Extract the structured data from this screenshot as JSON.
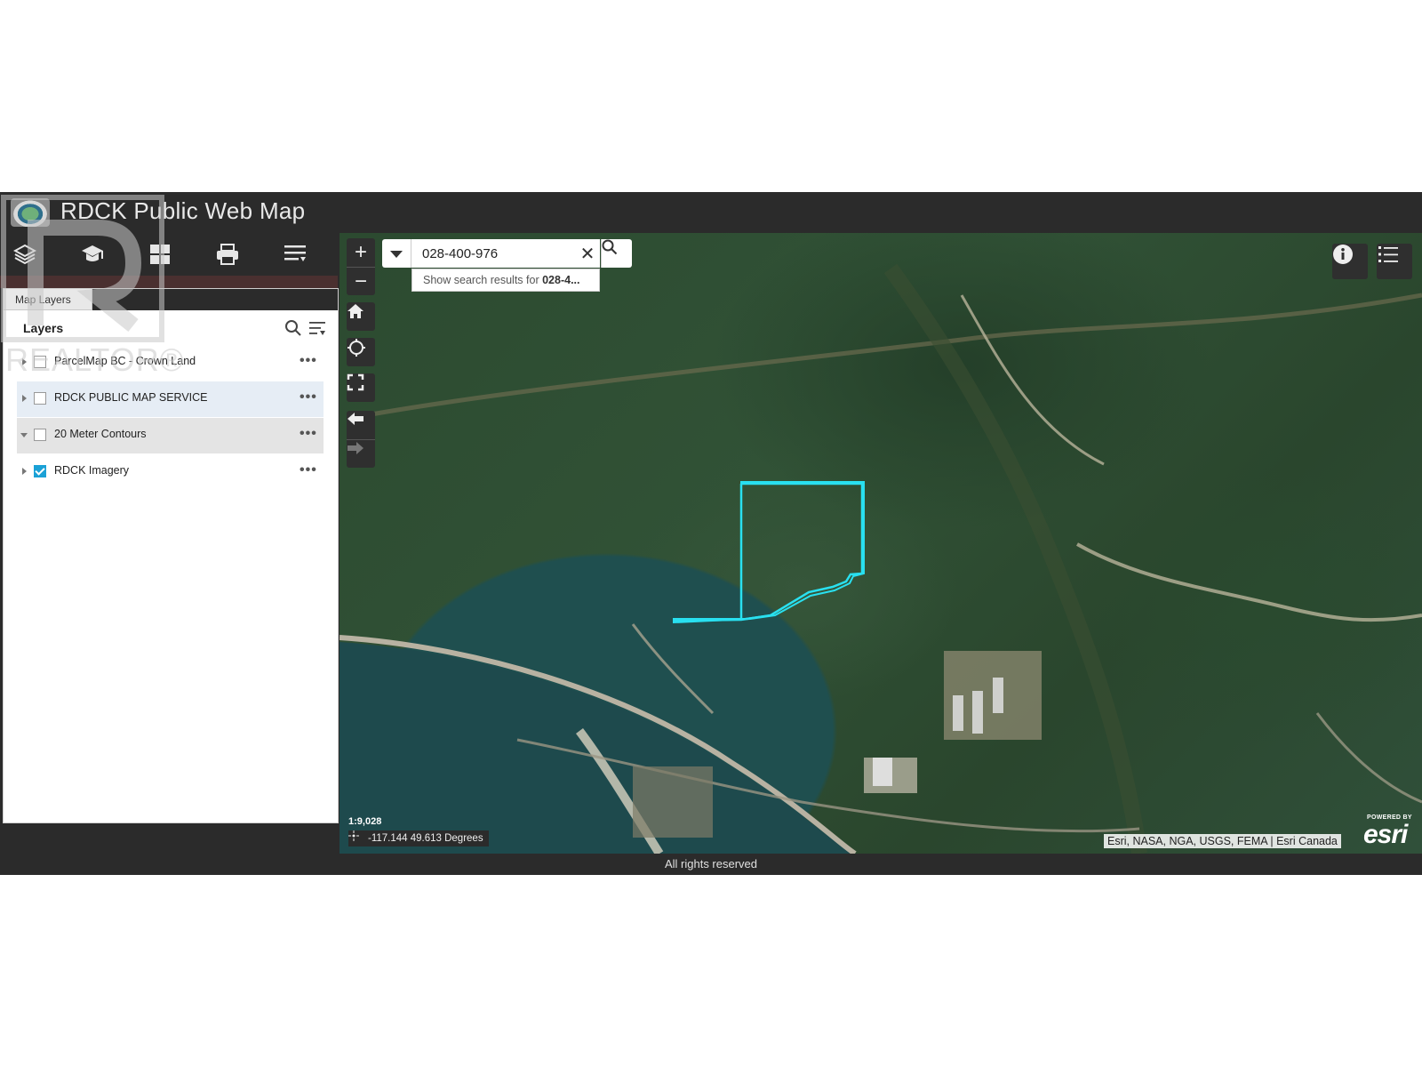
{
  "app": {
    "title": "RDCK Public Web Map",
    "footer": "All rights reserved"
  },
  "toolbar": {
    "icons": [
      "layers-icon",
      "legend-icon",
      "basemap-gallery-icon",
      "print-icon",
      "menu-icon"
    ]
  },
  "panel": {
    "tab_label": "Map Layers",
    "heading": "Layers",
    "layers": [
      {
        "label": "ParcelMap BC - Crown Land",
        "checked": false
      },
      {
        "label": "RDCK PUBLIC MAP SERVICE",
        "checked": false
      },
      {
        "label": "20 Meter Contours",
        "checked": false
      },
      {
        "label": "RDCK Imagery",
        "checked": true
      }
    ],
    "more_glyph": "•••",
    "collapse_glyph": "◀◀"
  },
  "search": {
    "value": "028-400-976",
    "suggestion_prefix": "Show search results for ",
    "suggestion_term": "028-4..."
  },
  "map": {
    "scale": "1:9,028",
    "coordinates": "-117.144 49.613 Degrees",
    "attribution": "Esri, NASA, NGA, USGS, FEMA | Esri Canada",
    "esri_powered": "POWERED BY",
    "esri_word": "esri",
    "parcel_color": "#29e0f0"
  },
  "watermark": {
    "text": "REALTOR®"
  }
}
